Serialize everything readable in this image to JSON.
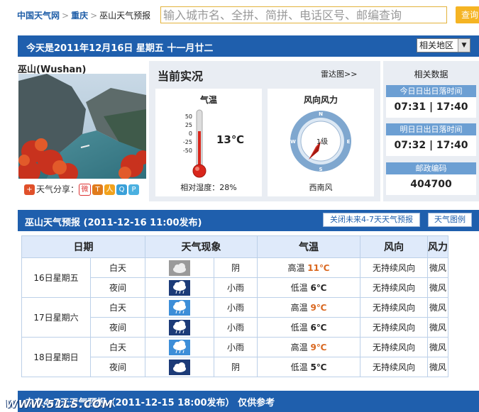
{
  "breadcrumb": {
    "site": "中国天气网",
    "province": "重庆",
    "current": "巫山天气预报",
    "sep": ">"
  },
  "search": {
    "placeholder": "输入城市名、全拼、简拼、电话区号、邮编查询",
    "button": "查询"
  },
  "datebar": {
    "text": "今天是2011年12月16日  星期五  十一月廿二",
    "area_select": "相关地区"
  },
  "city": {
    "name": "巫山(Wushan)",
    "share_label": "天气分享："
  },
  "realtime": {
    "title": "当前实况",
    "radar": "雷达图>>",
    "temp_title": "气温",
    "temp_value": "13℃",
    "temp_ticks": [
      "50",
      "25",
      "0",
      "-25",
      "-50"
    ],
    "humidity": "相对湿度：28%",
    "wind_title": "风向风力",
    "wind_level": "1级",
    "wind_dir": "西南风",
    "compass": {
      "n": "N",
      "e": "E",
      "s": "S",
      "w": "W"
    }
  },
  "related": {
    "title": "相关数据",
    "today_label": "今日日出日落时间",
    "today_value": "07:31  |  17:40",
    "tomorrow_label": "明日日出日落时间",
    "tomorrow_value": "07:32  |  17:40",
    "postal_label": "邮政编码",
    "postal_value": "404700"
  },
  "forecast": {
    "title": "巫山天气预报  (2011-12-16  11:00发布)",
    "btn_close": "关闭未来4-7天天气预报",
    "btn_legend": "天气图例",
    "headers": [
      "日期",
      "天气现象",
      "气温",
      "风向",
      "风力"
    ],
    "days": [
      {
        "date": "16日星期五",
        "red": false,
        "rows": [
          {
            "period": "白天",
            "icon": "cloudy-icon",
            "weather": "阴",
            "tlabel": "高温",
            "temp": "11℃",
            "hi": true,
            "wdir": "无持续风向",
            "wforce": "微风"
          },
          {
            "period": "夜间",
            "icon": "light-rain-night-icon",
            "weather": "小雨",
            "tlabel": "低温",
            "temp": "6℃",
            "hi": false,
            "wdir": "无持续风向",
            "wforce": "微风"
          }
        ]
      },
      {
        "date": "17日星期六",
        "red": true,
        "rows": [
          {
            "period": "白天",
            "icon": "light-rain-icon",
            "weather": "小雨",
            "tlabel": "高温",
            "temp": "9℃",
            "hi": true,
            "wdir": "无持续风向",
            "wforce": "微风"
          },
          {
            "period": "夜间",
            "icon": "light-rain-night-icon",
            "weather": "小雨",
            "tlabel": "低温",
            "temp": "6℃",
            "hi": false,
            "wdir": "无持续风向",
            "wforce": "微风"
          }
        ]
      },
      {
        "date": "18日星期日",
        "red": true,
        "rows": [
          {
            "period": "白天",
            "icon": "light-rain-icon",
            "weather": "小雨",
            "tlabel": "高温",
            "temp": "9℃",
            "hi": true,
            "wdir": "无持续风向",
            "wforce": "微风"
          },
          {
            "period": "夜间",
            "icon": "cloudy-night-icon",
            "weather": "阴",
            "tlabel": "低温",
            "temp": "5℃",
            "hi": false,
            "wdir": "无持续风向",
            "wforce": "微风"
          }
        ]
      }
    ]
  },
  "bottom": {
    "text": "未来4-7天天气预报（2011-12-15 18:00发布）    仅供参考"
  },
  "watermark": "WWW.51LS.COM",
  "colors": {
    "brand_blue": "#1f5fad",
    "accent_orange": "#d9661d",
    "weekend_red": "#dd3333"
  }
}
